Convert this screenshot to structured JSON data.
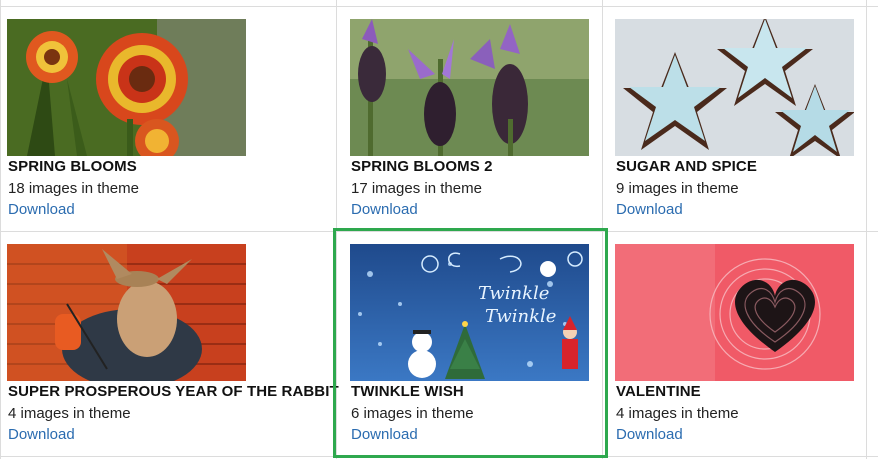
{
  "themes": [
    {
      "title": "SPRING BLOOMS",
      "count": "18 images in theme",
      "download": "Download"
    },
    {
      "title": "SPRING BLOOMS 2",
      "count": "17 images in theme",
      "download": "Download"
    },
    {
      "title": "SUGAR AND SPICE",
      "count": "9 images in theme",
      "download": "Download"
    },
    {
      "title": "SUPER PROSPEROUS YEAR OF THE RABBIT",
      "count": "4 images in theme",
      "download": "Download"
    },
    {
      "title": "TWINKLE WISH",
      "count": "6 images in theme",
      "download": "Download"
    },
    {
      "title": "VALENTINE",
      "count": "4 images in theme",
      "download": "Download"
    }
  ],
  "selected_index": 4,
  "selection_color": "#2ea84e",
  "link_color": "#2b6cb0"
}
